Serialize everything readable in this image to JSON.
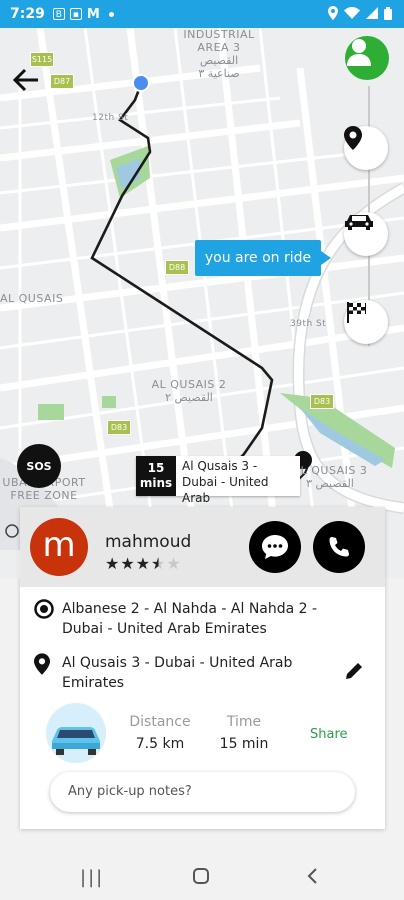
{
  "status_bar": {
    "time": "7:29",
    "icons": [
      "b-icon",
      "image-icon",
      "gmail-icon",
      "dot-icon",
      "location-icon",
      "wifi-icon",
      "signal-icon",
      "battery-icon"
    ]
  },
  "map": {
    "labels": {
      "industrial_area_3": "INDUSTRIAL\nAREA 3\nالقصيص\nصناعية ٣",
      "al_qusais": "AL QUSAIS",
      "al_qusais_2": "AL QUSAIS 2\nالقصيص ٢",
      "al_qusais_3": "AL QUSAIS 3\nالقصيص ٣",
      "airport": "UBAI AIRPORT\nFREE ZONE"
    },
    "shields": [
      "S115",
      "D87",
      "D88",
      "D83",
      "D83"
    ],
    "street_labels": [
      "12th St",
      "39th St",
      "8th St",
      "9th St",
      "8th St"
    ],
    "ride_tooltip": "you are on ride",
    "sos_label": "SOS",
    "eta": {
      "minutes": "15",
      "unit": "mins",
      "address": "Al Qusais 3 - Dubai - United Arab"
    },
    "copyright": "©"
  },
  "driver": {
    "initial": "m",
    "name": "mahmoud",
    "rating": 3.5
  },
  "trip": {
    "pickup": "Albanese 2 - Al Nahda - Al Nahda 2 - Dubai - United Arab Emirates",
    "dropoff": "Al Qusais 3 - Dubai - United Arab Emirates",
    "distance_label": "Distance",
    "distance_value": "7.5 km",
    "time_label": "Time",
    "time_value": "15 min",
    "share_label": "Share",
    "notes_placeholder": "Any pick-up notes?"
  },
  "colors": {
    "brand_blue": "#1fa3e3",
    "avatar_green": "#2fae35",
    "driver_red": "#c8330b",
    "share_green": "#2a9d4f"
  }
}
